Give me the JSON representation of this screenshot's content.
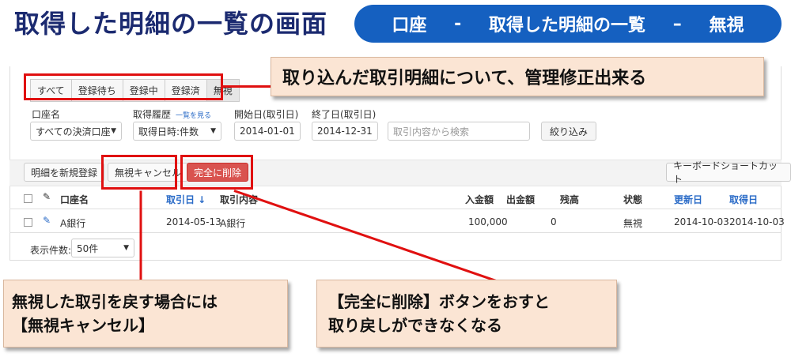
{
  "title": "取得した明細の一覧の画面",
  "breadcrumb": [
    "口座",
    "-",
    "取得した明細の一覧",
    "–",
    "無視"
  ],
  "filter_tabs": [
    "すべて",
    "登録待ち",
    "登録中",
    "登録済",
    "無視"
  ],
  "filters": {
    "account_label": "口座名",
    "account_value": "すべての決済口座",
    "history_label": "取得履歴",
    "history_link": "一覧を見る",
    "history_value": "取得日時:件数",
    "start_label": "開始日(取引日)",
    "start_value": "2014-01-01",
    "end_label": "終了日(取引日)",
    "end_value": "2014-12-31",
    "search_placeholder": "取引内容から検索",
    "filter_button": "絞り込み"
  },
  "toolbar": {
    "new_button": "明細を新規登録",
    "cancel_ignore_button": "無視キャンセル",
    "delete_button": "完全に削除",
    "shortcut_button": "キーボードショートカット"
  },
  "table": {
    "headers": {
      "account": "口座名",
      "txn_date": "取引日 ↓",
      "content": "取引内容",
      "deposit": "入金額",
      "withdrawal": "出金額",
      "balance": "残高",
      "status": "状態",
      "updated": "更新日",
      "fetched": "取得日"
    },
    "rows": [
      {
        "account": "A銀行",
        "txn_date": "2014-05-13",
        "content": "A銀行",
        "deposit": "100,000",
        "withdrawal": "0",
        "balance": "",
        "status": "無視",
        "updated": "2014-10-03",
        "fetched": "2014-10-03"
      }
    ]
  },
  "page_size": {
    "label": "表示件数:",
    "value": "50件"
  },
  "callouts": {
    "top": "取り込んだ取引明細について、管理修正出来る",
    "left_line1": "無視した取引を戻す場合には",
    "left_line2": "【無視キャンセル】",
    "right_line1": "【完全に削除】ボタンをおすと",
    "right_line2": "取り戻しができなくなる"
  },
  "colors": {
    "title": "#1b2a70",
    "pill": "#1560c0",
    "highlight": "#e01010",
    "delete_button": "#d9534f",
    "link": "#2a6bc7",
    "callout_bg": "#fbe5d4"
  }
}
